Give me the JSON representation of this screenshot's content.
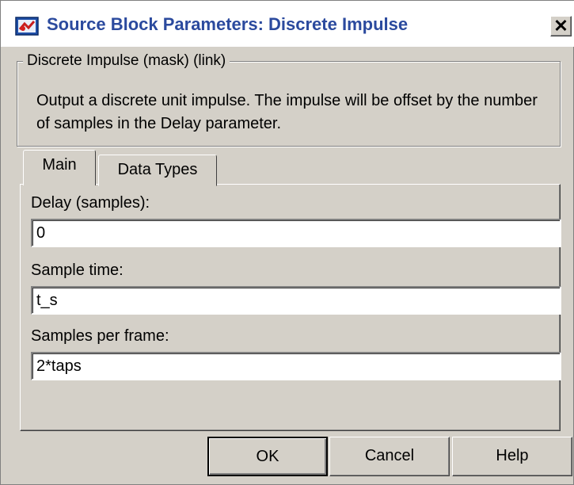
{
  "window": {
    "title": "Source Block Parameters: Discrete Impulse",
    "title_icon": "simulink-block-icon",
    "close_label": "✕"
  },
  "group": {
    "legend": "Discrete Impulse  (mask) (link)",
    "description": "Output a discrete unit impulse.  The impulse will be offset by the number of samples in the Delay parameter."
  },
  "tabs": [
    {
      "label": "Main",
      "selected": true
    },
    {
      "label": "Data Types",
      "selected": false
    }
  ],
  "fields": [
    {
      "label": "Delay (samples):",
      "value": "0"
    },
    {
      "label": "Sample time:",
      "value": "t_s"
    },
    {
      "label": "Samples per frame:",
      "value": "2*taps"
    }
  ],
  "buttons": {
    "ok": "OK",
    "cancel": "Cancel",
    "help": "Help"
  }
}
